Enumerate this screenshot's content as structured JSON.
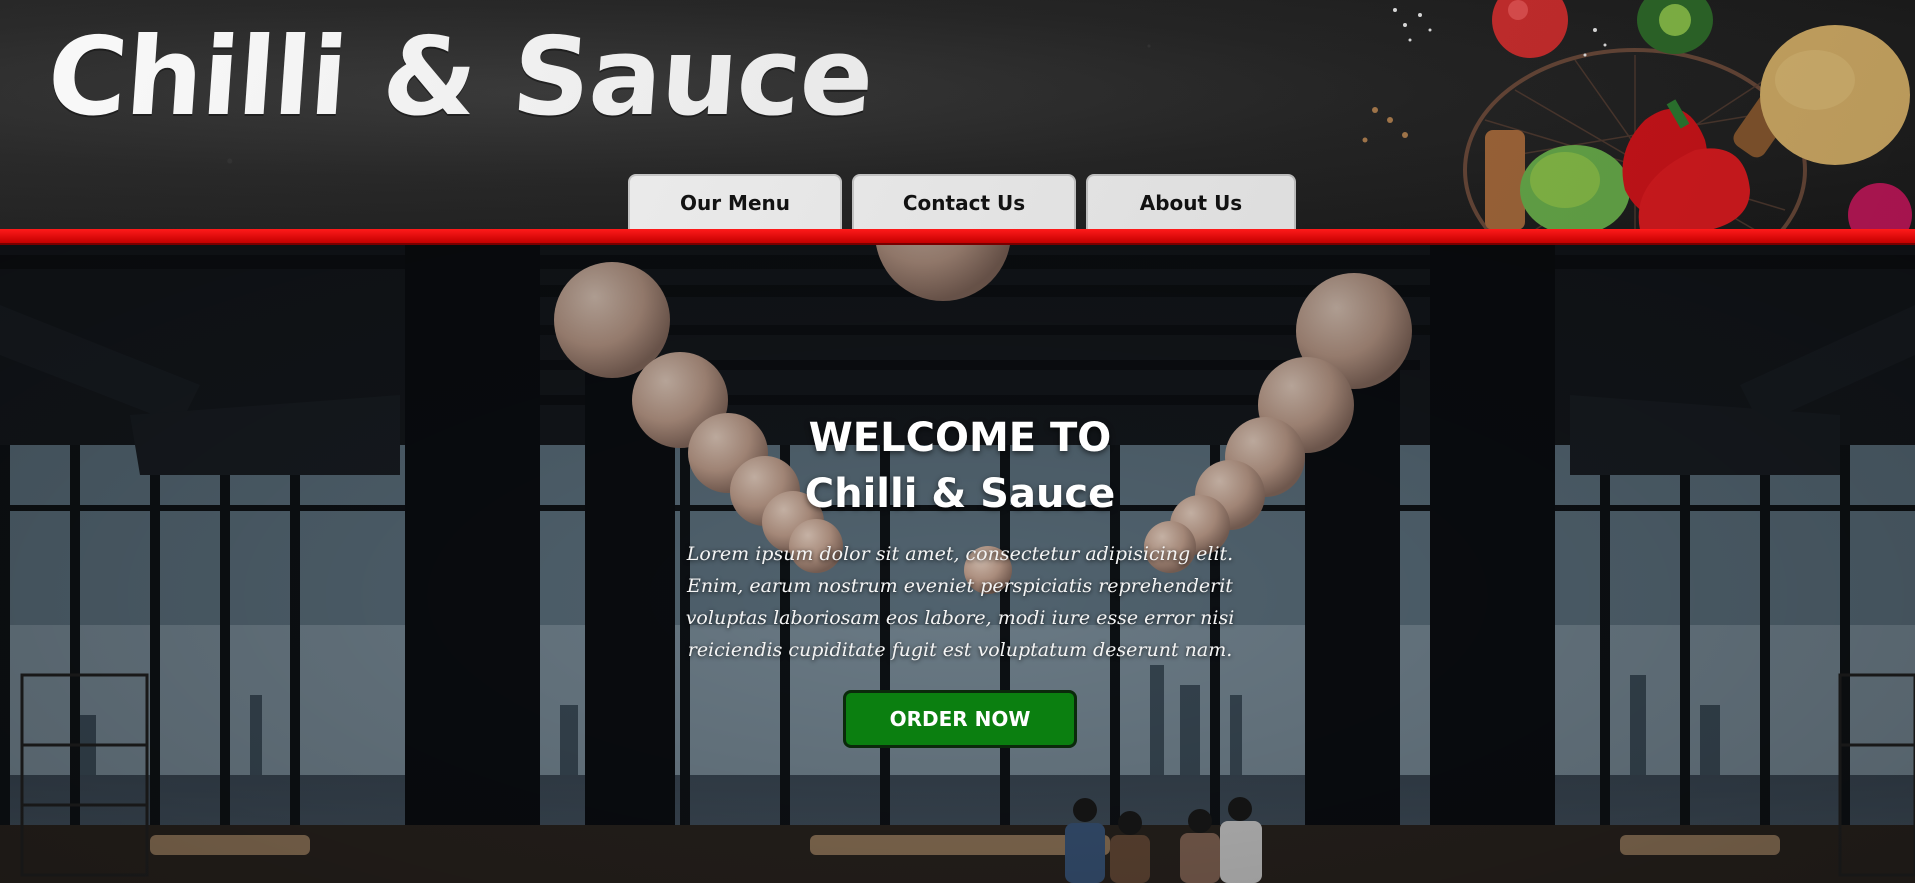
{
  "brand": {
    "name": "Chilli & Sauce"
  },
  "nav": {
    "items": [
      {
        "label": "Our Menu"
      },
      {
        "label": "Contact Us"
      },
      {
        "label": "About Us"
      }
    ]
  },
  "hero": {
    "title_line1": "WELCOME TO",
    "title_line2": "Chilli & Sauce",
    "text": "Lorem ipsum dolor sit amet, consectetur adipisicing elit. Enim, earum nostrum eveniet perspiciatis reprehenderit voluptas laboriosam eos labore, modi iure esse error nisi reiciendis cupiditate fugit est voluptatum deserunt nam.",
    "cta_label": "ORDER NOW"
  },
  "colors": {
    "header_bg": "#262626",
    "accent_red": "#e00000",
    "nav_bg": "#f7f7f7",
    "cta_green": "#0b7f10"
  },
  "icons": {
    "header_decoration": "vegetables-illustration",
    "hero_background": "restaurant-interior-photo"
  }
}
